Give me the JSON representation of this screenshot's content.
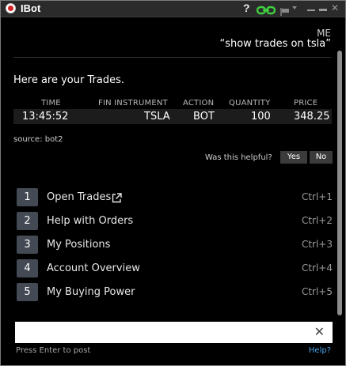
{
  "window": {
    "title": "IBot",
    "help_glyph": "?",
    "icons": [
      "app-logo-icon",
      "help-icon",
      "link-icon",
      "flag-icon",
      "dropdown-icon",
      "minimize-icon",
      "maximize-icon",
      "close-icon"
    ]
  },
  "conversation": {
    "user_label": "ME",
    "user_message": "“show trades on tsla”",
    "reply_title": "Here are your Trades."
  },
  "trades": {
    "columns": [
      "TIME",
      "FIN INSTRUMENT",
      "ACTION",
      "QUANTITY",
      "PRICE"
    ],
    "rows": [
      {
        "time": "13:45:52",
        "instrument": "TSLA",
        "action": "BOT",
        "quantity": "100",
        "price": "348.25"
      }
    ]
  },
  "source": "source: bot2",
  "feedback": {
    "question": "Was this helpful?",
    "yes": "Yes",
    "no": "No"
  },
  "menu": [
    {
      "num": "1",
      "label": "Open Trades",
      "shortcut": "Ctrl+1",
      "icon": "external-link-icon"
    },
    {
      "num": "2",
      "label": "Help with Orders",
      "shortcut": "Ctrl+2"
    },
    {
      "num": "3",
      "label": "My Positions",
      "shortcut": "Ctrl+3"
    },
    {
      "num": "4",
      "label": "Account Overview",
      "shortcut": "Ctrl+4"
    },
    {
      "num": "5",
      "label": "My Buying Power",
      "shortcut": "Ctrl+5"
    }
  ],
  "input": {
    "value": "",
    "clear_glyph": "✕",
    "hint": "Press Enter to post",
    "help_link": "Help?"
  },
  "colors": {
    "background": "#000000",
    "titlebar": "#2b2b2b",
    "menu_number": "#444a54",
    "link_icon": "#3fcf3f",
    "help_link": "#4aa3e8"
  }
}
